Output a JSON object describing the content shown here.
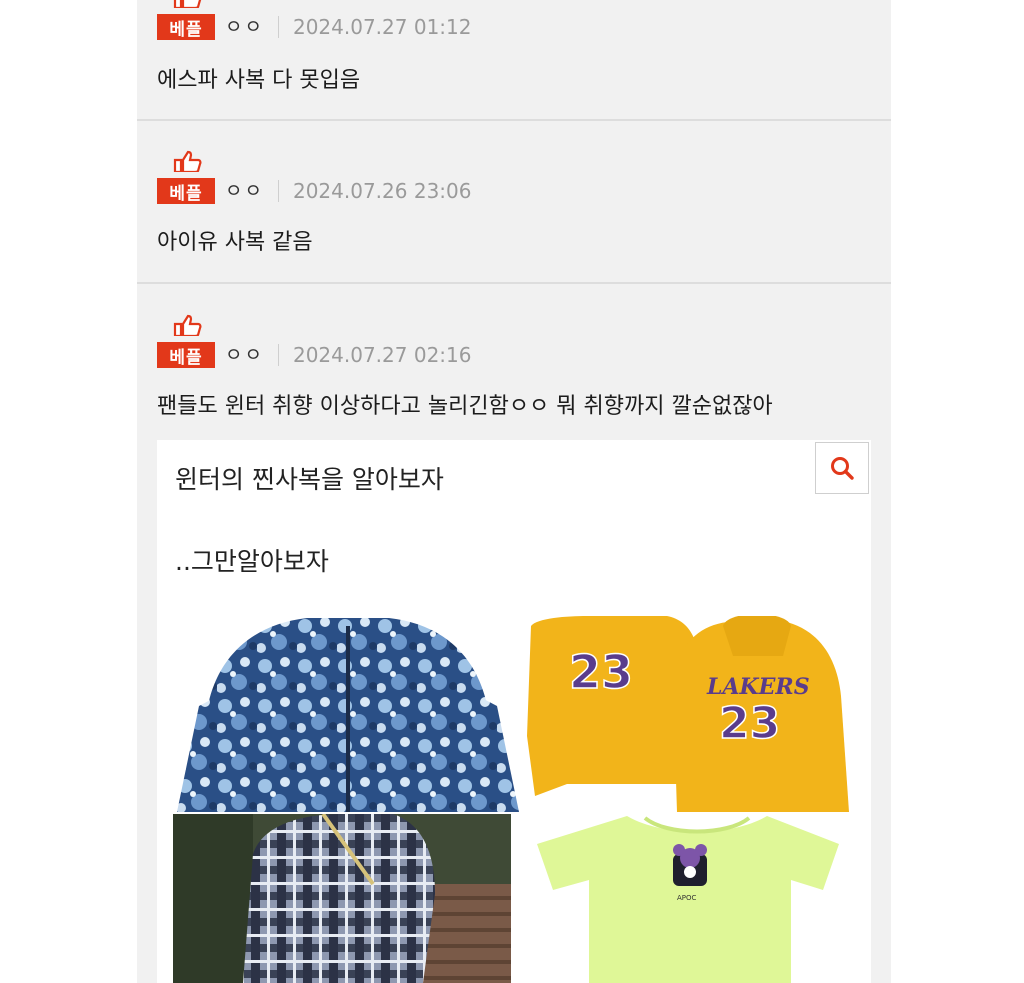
{
  "comments": [
    {
      "badge": "베플",
      "author": "ㅇㅇ",
      "timestamp": "2024.07.27 01:12",
      "text": "에스파 사복 다 못입음"
    },
    {
      "badge": "베플",
      "author": "ㅇㅇ",
      "timestamp": "2024.07.26 23:06",
      "text": "아이유 사복 같음"
    },
    {
      "badge": "베플",
      "author": "ㅇㅇ",
      "timestamp": "2024.07.27 02:16",
      "text": "팬들도 윈터 취향 이상하다고 놀리긴함ㅇㅇ 뭐 취향까지 깔순없잖아"
    }
  ],
  "embedded_post": {
    "title": "윈터의 찐사복을 알아보자",
    "subtitle": "..그만알아보자",
    "search_icon": "search-icon",
    "images": [
      {
        "name": "tie-dye-hoodie-photo"
      },
      {
        "name": "lakers-23-hoodies-photo",
        "print": "23",
        "logo": "LAKERS"
      },
      {
        "name": "plaid-shirt-photo"
      },
      {
        "name": "neon-bear-tshirt-photo",
        "print": "APOC"
      }
    ]
  },
  "colors": {
    "badge": "#e2381a",
    "background": "#f1f1f1",
    "accent": "#e2381a"
  }
}
